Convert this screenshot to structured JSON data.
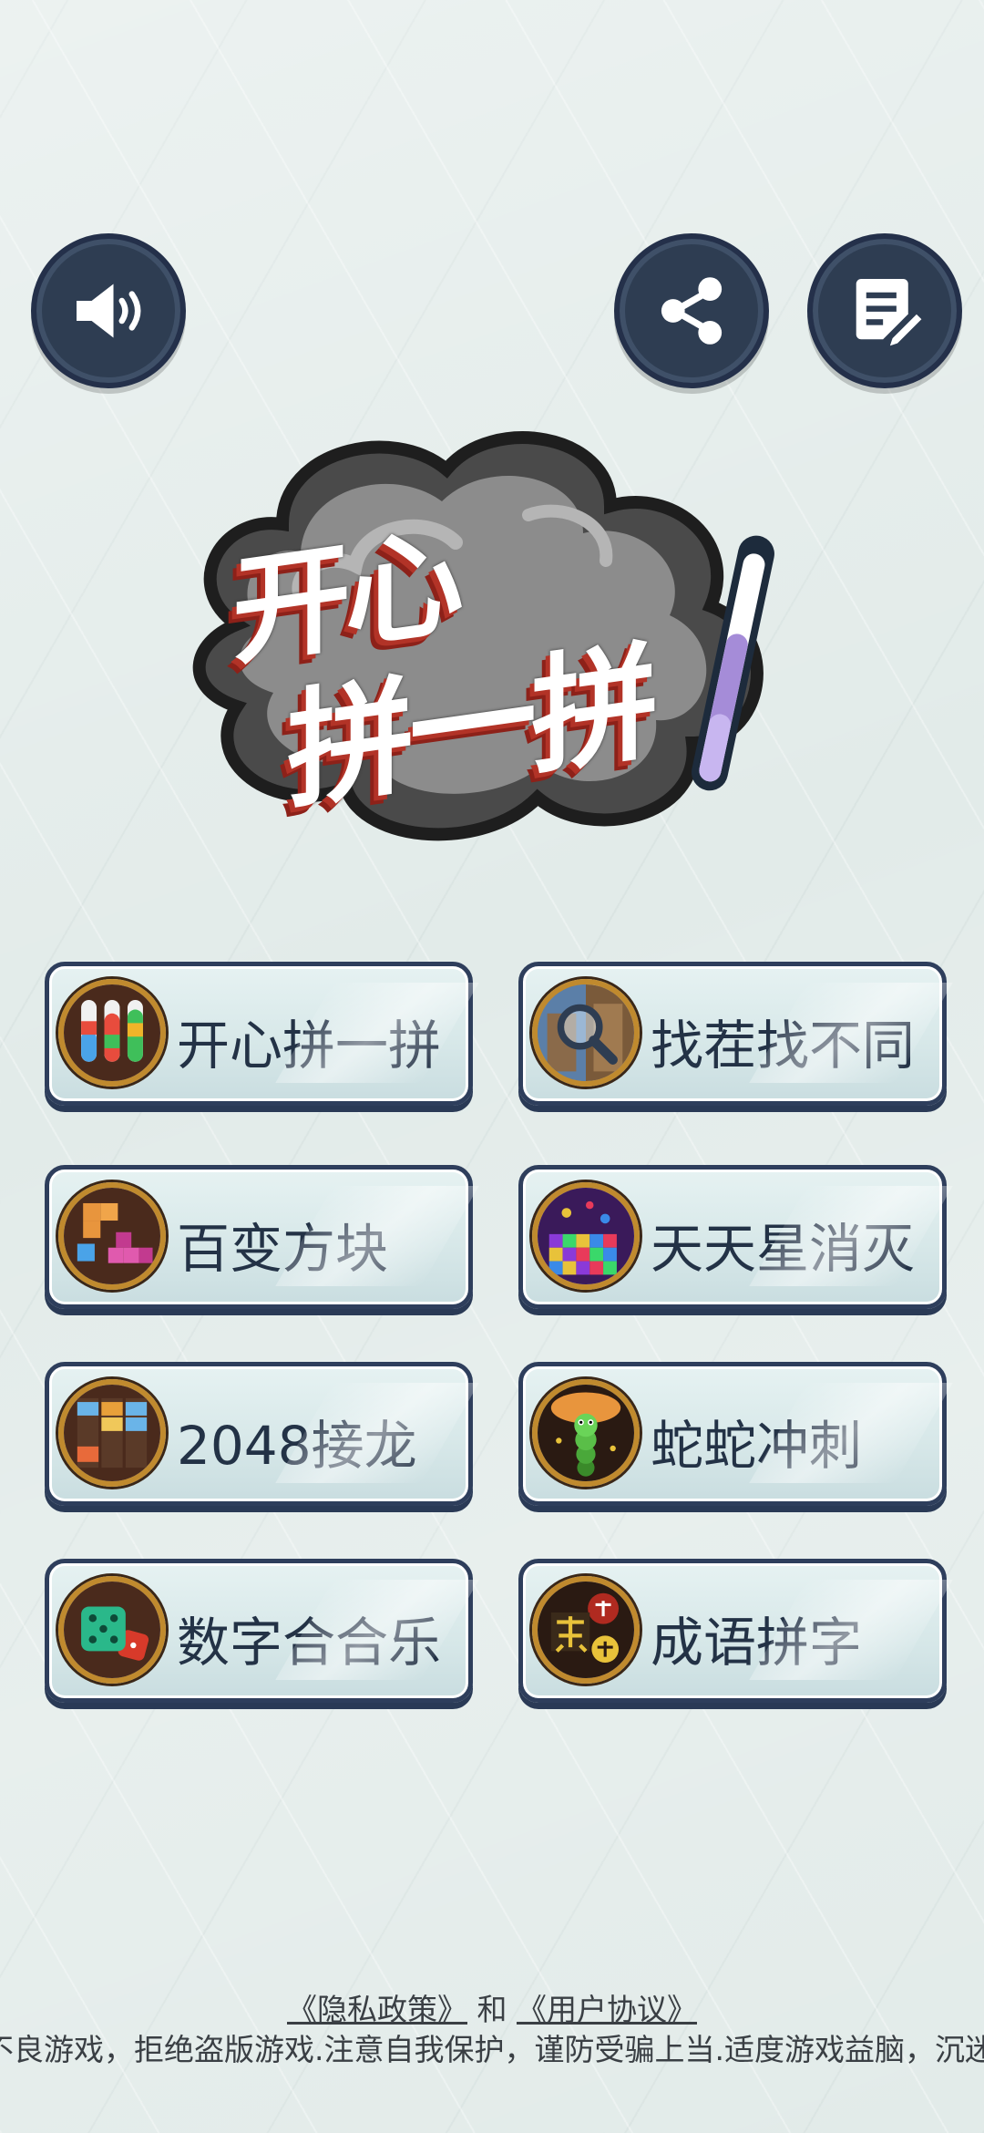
{
  "header": {
    "sound_icon": "speaker-volume-icon",
    "share_icon": "share-icon",
    "notes_icon": "note-edit-icon"
  },
  "logo": {
    "line1": "开心",
    "line2": "拼一拼"
  },
  "games": [
    {
      "label": "开心拼一拼",
      "icon": "color-tubes-icon"
    },
    {
      "label": "找茬找不同",
      "icon": "magnifier-photo-icon"
    },
    {
      "label": "百变方块",
      "icon": "blocks-icon"
    },
    {
      "label": "天天星消灭",
      "icon": "star-blocks-icon"
    },
    {
      "label": "2048接龙",
      "icon": "number-columns-icon"
    },
    {
      "label": "蛇蛇冲刺",
      "icon": "snake-icon"
    },
    {
      "label": "数字合合乐",
      "icon": "dice-icon"
    },
    {
      "label": "成语拼字",
      "icon": "idiom-characters-icon"
    }
  ],
  "footer": {
    "privacy": "《隐私政策》",
    "and": " 和 ",
    "agreement": "《用户协议》",
    "notice": "不良游戏，拒绝盗版游戏.注意自我保护，谨防受骗上当.适度游戏益脑，沉迷"
  },
  "colors": {
    "button_dark": "#2e3d52",
    "button_border": "#2e3e5c",
    "text_dark": "#233246",
    "background": "#e2ebe9"
  }
}
